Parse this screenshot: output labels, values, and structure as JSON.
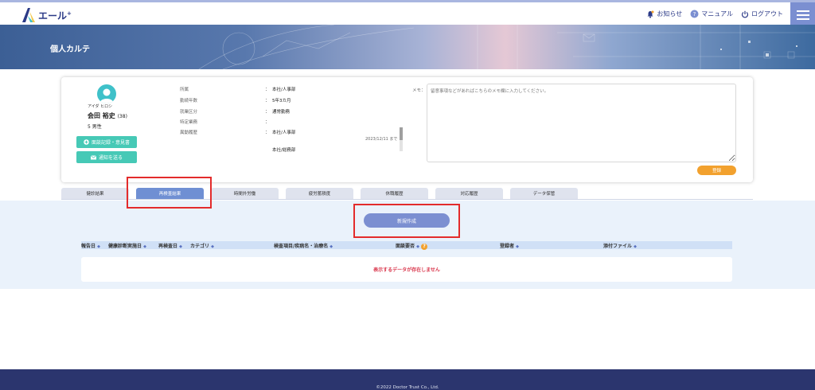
{
  "header": {
    "logo_text": "エール",
    "logo_sup": "+",
    "nav": [
      {
        "label": "お知らせ",
        "icon": "bell-icon"
      },
      {
        "label": "マニュアル",
        "icon": "help-icon"
      },
      {
        "label": "ログアウト",
        "icon": "power-icon"
      }
    ]
  },
  "banner": {
    "title": "個人カルテ"
  },
  "profile": {
    "kana": "アイダ ヒロシ",
    "name": "会田 裕史",
    "age": "(38)",
    "gender": "5  男性",
    "buttons": {
      "record": "面談記録・意見書",
      "notify": "通知を送る"
    },
    "info": [
      {
        "label": "所属",
        "value": "本社/人事部"
      },
      {
        "label": "勤続年数",
        "value": "5年3カ月"
      },
      {
        "label": "就業区分",
        "value": "通常勤務"
      },
      {
        "label": "特定業務",
        "value": ""
      },
      {
        "label": "異動履歴",
        "value": "本社/人事部"
      }
    ],
    "history_date": "2023/12/11 まで",
    "history_next": "本社/総務部",
    "colon": "："
  },
  "memo": {
    "label": "メモ：",
    "placeholder": "留意事項などがあればこちらのメモ欄に入力してください。",
    "register": "登録"
  },
  "tabs": [
    {
      "label": "健診結果",
      "active": false
    },
    {
      "label": "再検査結果",
      "active": true
    },
    {
      "label": "時間外労働",
      "active": false
    },
    {
      "label": "疲労蓄積度",
      "active": false
    },
    {
      "label": "休職履歴",
      "active": false
    },
    {
      "label": "対応履歴",
      "active": false
    },
    {
      "label": "データ保管",
      "active": false
    }
  ],
  "content": {
    "new_button": "新規作成",
    "columns": [
      "報告日",
      "健康診断実施日",
      "再検査日",
      "カテゴリ",
      "検査項目/疾病名・治療名",
      "面談要否",
      "登録者",
      "添付ファイル"
    ],
    "sort_icon": "◆",
    "help_glyph": "?",
    "empty": "表示するデータが存在しません"
  },
  "footer": {
    "copyright": "©2022 Doctor Trust Co., Ltd."
  },
  "colors": {
    "accent": "#7b8fd1",
    "teal": "#46c9b6",
    "orange": "#f2a12e",
    "highlight": "#e32b2b",
    "footer": "#2b356e"
  }
}
